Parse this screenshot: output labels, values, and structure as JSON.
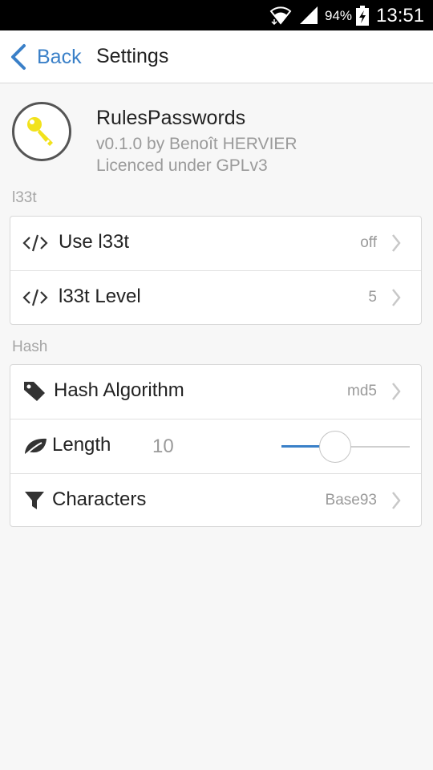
{
  "status_bar": {
    "battery_percent": "94%",
    "time": "13:51",
    "icons": [
      "wifi-icon",
      "signal-icon",
      "battery-charging-icon"
    ]
  },
  "nav": {
    "back_label": "Back",
    "title": "Settings"
  },
  "app": {
    "logo_icon": "key-icon",
    "name": "RulesPasswords",
    "version": "v0.1.0 by Benoît HERVIER",
    "license": "Licenced under GPLv3"
  },
  "sections": {
    "l33t": {
      "header": "l33t",
      "use_l33t": {
        "label": "Use l33t",
        "value": "off",
        "icon": "code-icon"
      },
      "l33t_level": {
        "label": "l33t Level",
        "value": "5",
        "icon": "code-icon"
      }
    },
    "hash": {
      "header": "Hash",
      "hash_algorithm": {
        "label": "Hash Algorithm",
        "value": "md5",
        "icon": "tag-icon"
      },
      "length": {
        "label": "Length",
        "value": "10",
        "icon": "leaf-icon",
        "slider_fraction": 0.42
      },
      "characters": {
        "label": "Characters",
        "value": "Base93",
        "icon": "filter-icon"
      }
    }
  },
  "colors": {
    "accent": "#3a80c8",
    "logo_key": "#f2e21c"
  }
}
